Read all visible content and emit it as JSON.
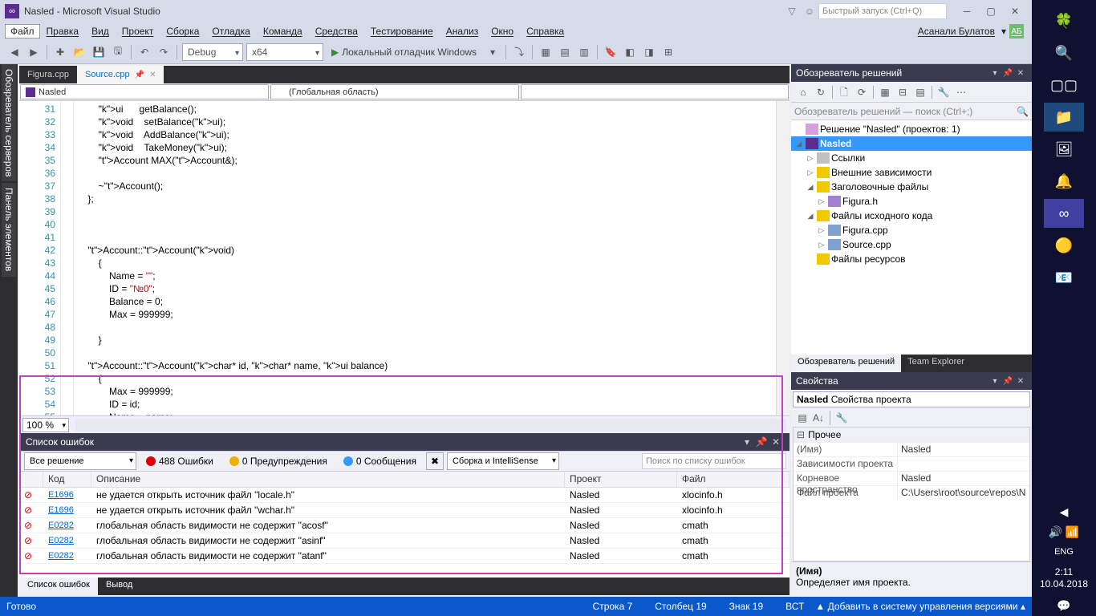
{
  "title": "Nasled - Microsoft Visual Studio",
  "quicklaunch_placeholder": "Быстрый запуск (Ctrl+Q)",
  "menus": [
    "Файл",
    "Правка",
    "Вид",
    "Проект",
    "Сборка",
    "Отладка",
    "Команда",
    "Средства",
    "Тестирование",
    "Анализ",
    "Окно",
    "Справка"
  ],
  "user_name": "Асанали Булатов",
  "user_initials": "АБ",
  "toolbar": {
    "config": "Debug",
    "platform": "x64",
    "run": "Локальный отладчик Windows"
  },
  "tabs": [
    {
      "label": "Figura.cpp",
      "active": false
    },
    {
      "label": "Source.cpp",
      "active": true
    }
  ],
  "nav": {
    "scope": "Nasled",
    "context": "(Глобальная область)"
  },
  "code_lines_start": 31,
  "code_lines": [
    {
      "n": 31,
      "t": "        ui      getBalance();"
    },
    {
      "n": 32,
      "t": "        void    setBalance(ui);"
    },
    {
      "n": 33,
      "t": "        void    AddBalance(ui);"
    },
    {
      "n": 34,
      "t": "        void    TakeMoney(ui);"
    },
    {
      "n": 35,
      "t": "        Account MAX(Account&);"
    },
    {
      "n": 36,
      "t": ""
    },
    {
      "n": 37,
      "t": "        ~Account();"
    },
    {
      "n": 38,
      "t": "    };"
    },
    {
      "n": 39,
      "t": ""
    },
    {
      "n": 40,
      "t": ""
    },
    {
      "n": 41,
      "t": ""
    },
    {
      "n": 42,
      "t": "    Account::Account(void)"
    },
    {
      "n": 43,
      "t": "        {"
    },
    {
      "n": 44,
      "t": "            Name = \"\";"
    },
    {
      "n": 45,
      "t": "            ID = \"№0\";"
    },
    {
      "n": 46,
      "t": "            Balance = 0;"
    },
    {
      "n": 47,
      "t": "            Max = 999999;"
    },
    {
      "n": 48,
      "t": ""
    },
    {
      "n": 49,
      "t": "        }"
    },
    {
      "n": 50,
      "t": ""
    },
    {
      "n": 51,
      "t": "    Account::Account(char* id, char* name, ui balance)"
    },
    {
      "n": 52,
      "t": "        {"
    },
    {
      "n": 53,
      "t": "            Max = 999999;"
    },
    {
      "n": 54,
      "t": "            ID = id;"
    },
    {
      "n": 55,
      "t": "            Name = name;"
    }
  ],
  "zoom": "100 %",
  "errorlist": {
    "title": "Список ошибок",
    "scope": "Все решение",
    "errors_btn": "488 Ошибки",
    "warnings_btn": "0 Предупреждения",
    "messages_btn": "0 Сообщения",
    "source": "Сборка и IntelliSense",
    "search_placeholder": "Поиск по списку ошибок",
    "columns": {
      "code": "Код",
      "desc": "Описание",
      "proj": "Проект",
      "file": "Файл"
    },
    "rows": [
      {
        "code": "E1696",
        "desc": "не удается открыть источник файл \"locale.h\"",
        "proj": "Nasled",
        "file": "xlocinfo.h"
      },
      {
        "code": "E1696",
        "desc": "не удается открыть источник файл \"wchar.h\"",
        "proj": "Nasled",
        "file": "xlocinfo.h"
      },
      {
        "code": "E0282",
        "desc": "глобальная область видимости не содержит \"acosf\"",
        "proj": "Nasled",
        "file": "cmath"
      },
      {
        "code": "E0282",
        "desc": "глобальная область видимости не содержит \"asinf\"",
        "proj": "Nasled",
        "file": "cmath"
      },
      {
        "code": "E0282",
        "desc": "глобальная область видимости не содержит \"atanf\"",
        "proj": "Nasled",
        "file": "cmath"
      }
    ]
  },
  "bottom_tabs": {
    "errors": "Список ошибок",
    "output": "Вывод"
  },
  "solution_explorer": {
    "title": "Обозреватель решений",
    "search_placeholder": "Обозреватель решений — поиск (Ctrl+;)",
    "solution": "Решение \"Nasled\"  (проектов: 1)",
    "project": "Nasled",
    "refs": "Ссылки",
    "ext": "Внешние зависимости",
    "headers": "Заголовочные файлы",
    "header_files": [
      "Figura.h"
    ],
    "sources": "Файлы исходного кода",
    "source_files": [
      "Figura.cpp",
      "Source.cpp"
    ],
    "resources": "Файлы ресурсов",
    "tabs": {
      "se": "Обозреватель решений",
      "te": "Team Explorer"
    }
  },
  "properties": {
    "title": "Свойства",
    "selector": "Nasled Свойства проекта",
    "selector_bold": "Nasled",
    "selector_rest": " Свойства проекта",
    "category": "Прочее",
    "rows": [
      {
        "k": "(Имя)",
        "v": "Nasled"
      },
      {
        "k": "Зависимости проекта",
        "v": ""
      },
      {
        "k": "Корневое пространство",
        "v": "Nasled"
      },
      {
        "k": "Файл проекта",
        "v": "C:\\Users\\root\\source\\repos\\N"
      }
    ],
    "desc_title": "(Имя)",
    "desc_text": "Определяет имя проекта."
  },
  "leftpanels": [
    "Обозреватель серверов",
    "Панель элементов"
  ],
  "status": {
    "ready": "Готово",
    "line": "Строка 7",
    "col": "Столбец 19",
    "char": "Знак 19",
    "mode": "ВСТ",
    "vcs": "Добавить в систему управления версиями"
  },
  "taskbar": {
    "lang": "ENG",
    "time": "2:11",
    "date": "10.04.2018"
  }
}
